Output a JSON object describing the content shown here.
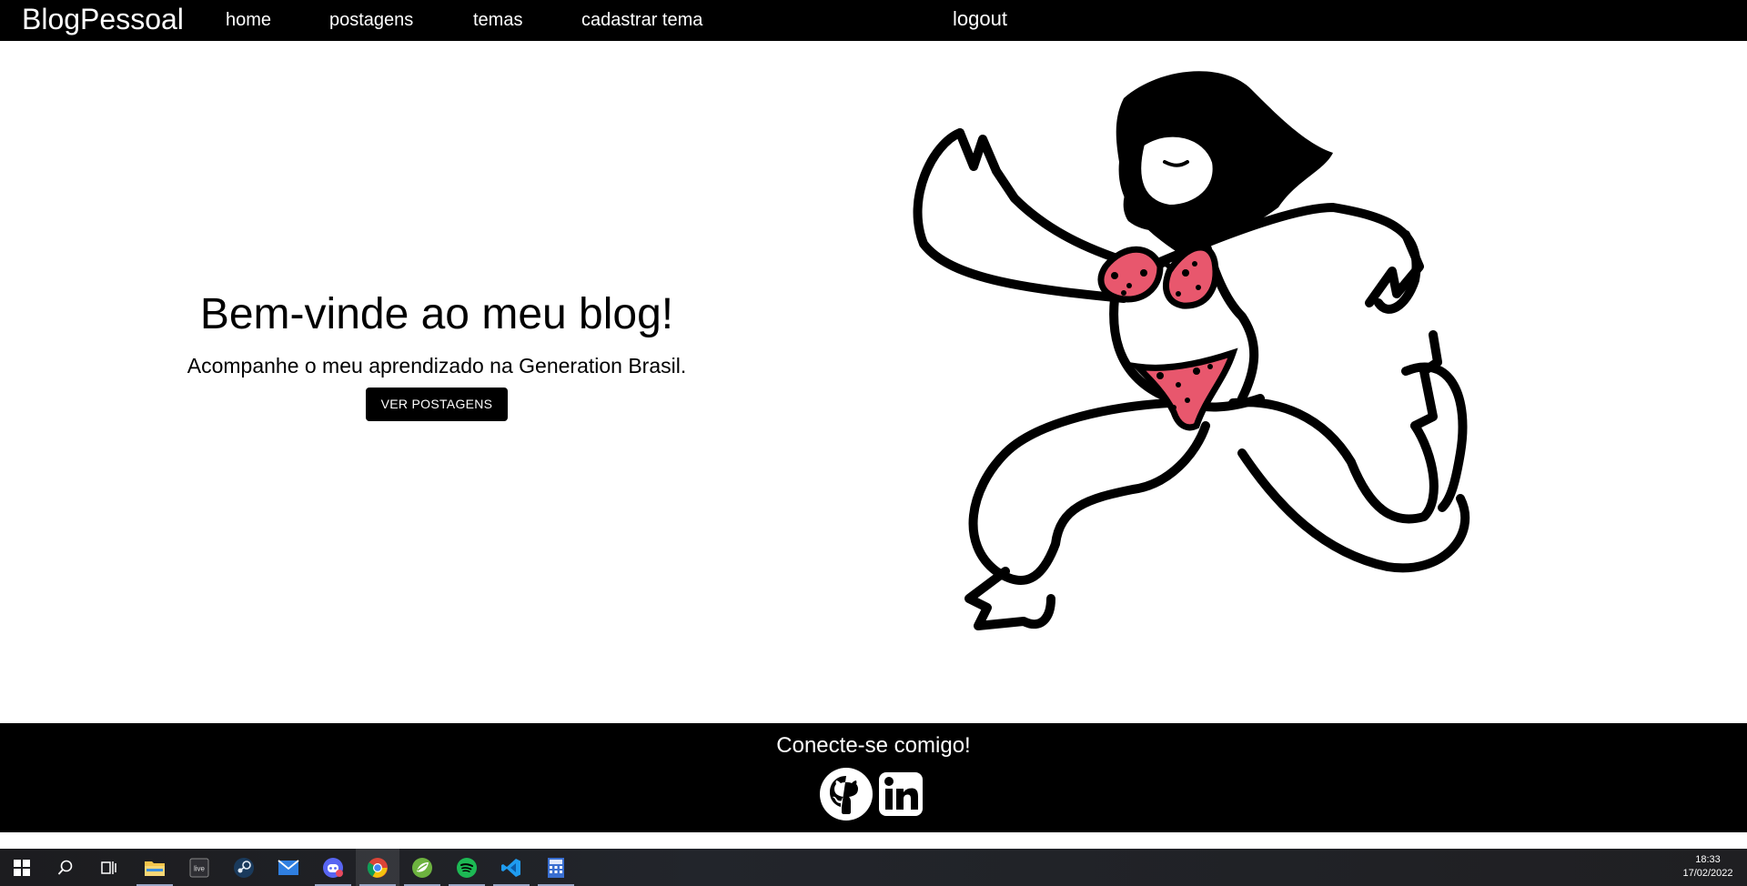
{
  "navbar": {
    "brand": "BlogPessoal",
    "links": [
      "home",
      "postagens",
      "temas",
      "cadastrar tema",
      "logout"
    ]
  },
  "hero": {
    "title": "Bem-vinde ao meu blog!",
    "subtitle": "Acompanhe o meu aprendizado na Generation Brasil.",
    "button_label": "VER POSTAGENS"
  },
  "footer": {
    "title": "Conecte-se comigo!",
    "icons": [
      "github-icon",
      "linkedin-icon"
    ]
  },
  "taskbar": {
    "apps": [
      "windows-start-icon",
      "search-icon",
      "task-view-icon",
      "file-explorer-icon",
      "live-icon",
      "steam-icon",
      "mail-icon",
      "discord-icon",
      "chrome-icon",
      "spring-icon",
      "spotify-icon",
      "vscode-icon",
      "calculator-icon"
    ],
    "time": "18:33",
    "date": "17/02/2022"
  },
  "colors": {
    "navbar_bg": "#000000",
    "footer_bg": "#000000",
    "accent_pink": "#e8576d",
    "button_bg": "#000000"
  }
}
